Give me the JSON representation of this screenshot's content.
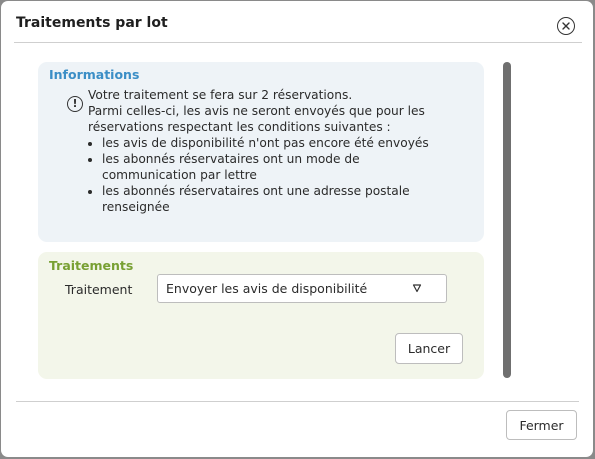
{
  "dialog": {
    "title": "Traitements par lot",
    "close_icon": "close-circle-icon"
  },
  "informations": {
    "heading": "Informations",
    "icon": "exclamation-circle-icon",
    "line1": "Votre traitement se fera sur 2 réservations.",
    "line2": "Parmi celles-ci, les avis ne seront envoyés que pour les réservations respectant les conditions suivantes :",
    "conditions": [
      "les avis de disponibilité n'ont pas encore été envoyés",
      "les abonnés réservataires ont un mode de communication par lettre",
      "les abonnés réservataires ont une adresse postale renseignée"
    ],
    "heading_color": "#3b8ec6"
  },
  "traitements": {
    "heading": "Traitements",
    "field_label": "Traitement",
    "selected_value": "Envoyer les avis de disponibilité",
    "dropdown_icon": "chevron-down-icon",
    "run_button": "Lancer",
    "heading_color": "#78a033"
  },
  "footer": {
    "close_button": "Fermer"
  }
}
